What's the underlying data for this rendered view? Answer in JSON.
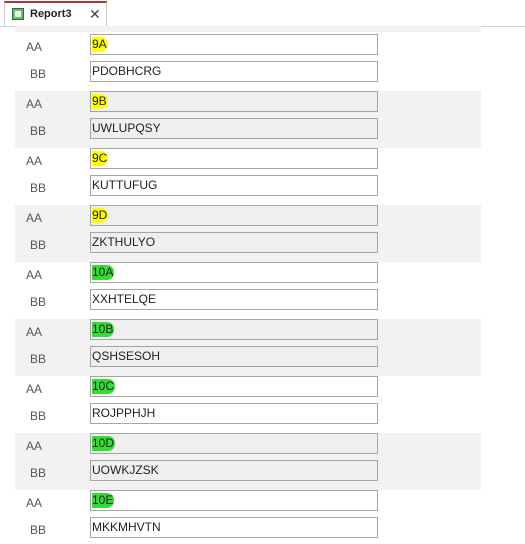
{
  "tab": {
    "title": "Report3",
    "close_glyph": "✕"
  },
  "colors": {
    "highlight_yellow": "#ffff00",
    "highlight_green": "#33dd33"
  },
  "labels": {
    "aa": "AA",
    "bb": "BB"
  },
  "records": [
    {
      "aa": "9A",
      "bb": "PDOBHCRG",
      "highlight": "yellow"
    },
    {
      "aa": "9B",
      "bb": "UWLUPQSY",
      "highlight": "yellow"
    },
    {
      "aa": "9C",
      "bb": "KUTTUFUG",
      "highlight": "yellow"
    },
    {
      "aa": "9D",
      "bb": "ZKTHULYO",
      "highlight": "yellow"
    },
    {
      "aa": "10A",
      "bb": "XXHTELQE",
      "highlight": "green"
    },
    {
      "aa": "10B",
      "bb": "QSHSESOH",
      "highlight": "green"
    },
    {
      "aa": "10C",
      "bb": "ROJPPHJH",
      "highlight": "green"
    },
    {
      "aa": "10D",
      "bb": "UOWKJZSK",
      "highlight": "green"
    },
    {
      "aa": "10E",
      "bb": "MKKMHVTN",
      "highlight": "green"
    }
  ]
}
